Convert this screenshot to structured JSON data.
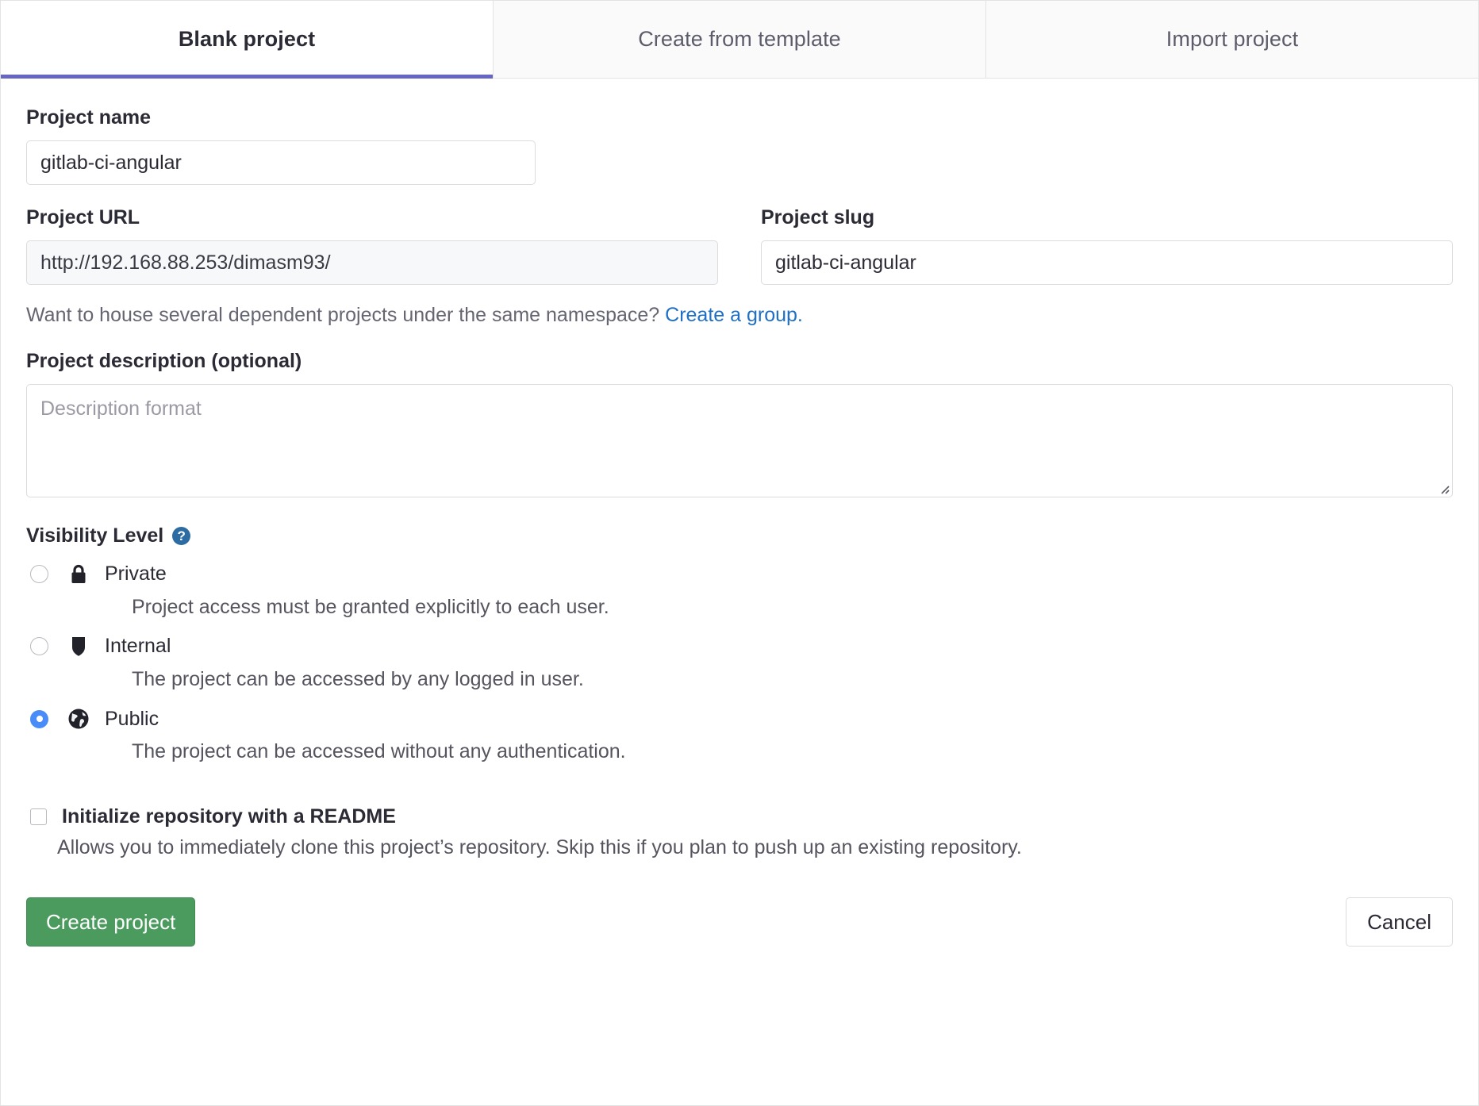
{
  "tabs": [
    {
      "label": "Blank project",
      "active": true
    },
    {
      "label": "Create from template",
      "active": false
    },
    {
      "label": "Import project",
      "active": false
    }
  ],
  "form": {
    "name_label": "Project name",
    "name_value": "gitlab-ci-angular",
    "url_label": "Project URL",
    "url_value": "http://192.168.88.253/dimasm93/",
    "slug_label": "Project slug",
    "slug_value": "gitlab-ci-angular",
    "namespace_hint": "Want to house several dependent projects under the same namespace?",
    "namespace_link": "Create a group.",
    "description_label": "Project description (optional)",
    "description_value": "",
    "description_placeholder": "Description format"
  },
  "visibility": {
    "heading": "Visibility Level",
    "help_icon": "question-mark-circle-icon",
    "options": [
      {
        "id": "private",
        "label": "Private",
        "icon": "lock-icon",
        "description": "Project access must be granted explicitly to each user.",
        "selected": false
      },
      {
        "id": "internal",
        "label": "Internal",
        "icon": "shield-icon",
        "description": "The project can be accessed by any logged in user.",
        "selected": false
      },
      {
        "id": "public",
        "label": "Public",
        "icon": "globe-icon",
        "description": "The project can be accessed without any authentication.",
        "selected": true
      }
    ]
  },
  "readme": {
    "label": "Initialize repository with a README",
    "description": "Allows you to immediately clone this project’s repository. Skip this if you plan to push up an existing repository.",
    "checked": false
  },
  "actions": {
    "submit_label": "Create project",
    "cancel_label": "Cancel"
  },
  "colors": {
    "active_tab_underline": "#6666c4",
    "link": "#1f6fc4",
    "primary_button": "#4b9b5f",
    "radio_selected": "#4a8cf7",
    "help_icon": "#2d6ca2"
  }
}
